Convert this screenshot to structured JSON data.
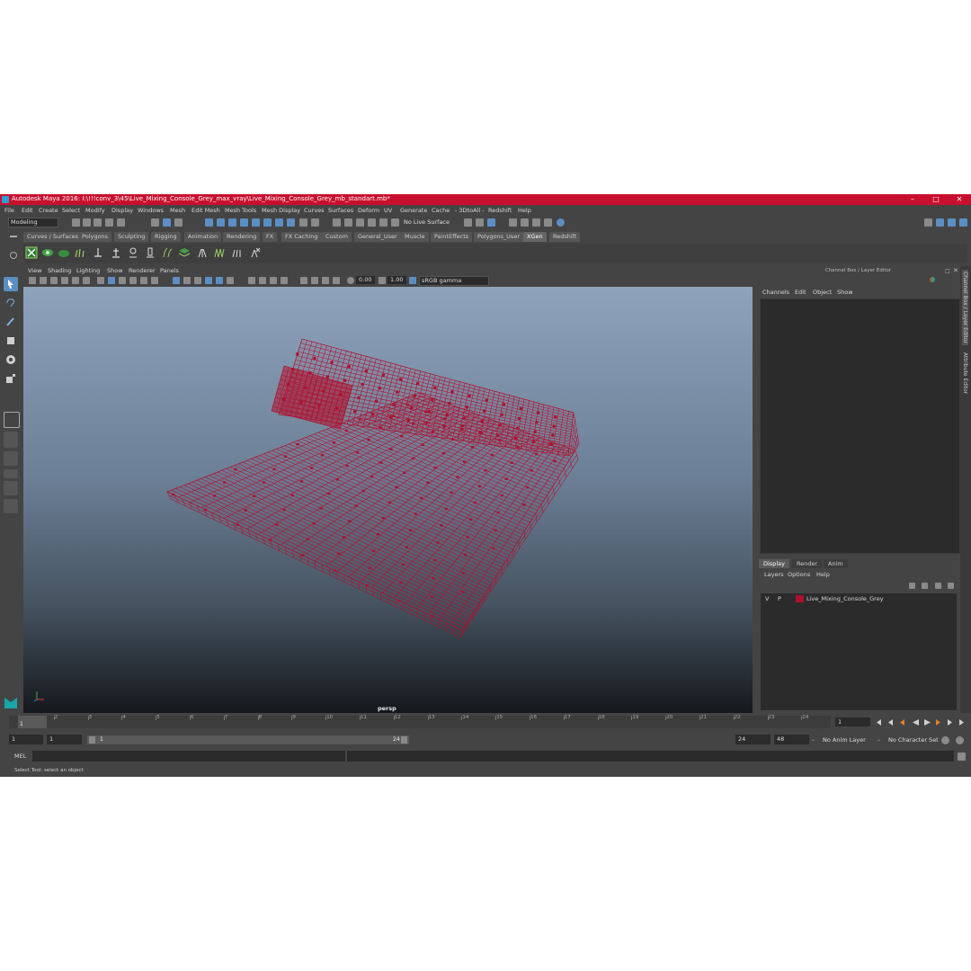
{
  "window": {
    "title": "Autodesk Maya 2016: I:\\!!!conv_3\\45\\Live_Mixing_Console_Grey_max_vray\\Live_Mixing_Console_Grey_mb_standart.mb*"
  },
  "menubar": [
    "File",
    "Edit",
    "Create",
    "Select",
    "Modify",
    "Display",
    "Windows",
    "Mesh",
    "Edit Mesh",
    "Mesh Tools",
    "Mesh Display",
    "Curves",
    "Surfaces",
    "Deform",
    "UV",
    "Generate",
    "Cache",
    "- 3DtoAll -",
    "Redshift",
    "Help"
  ],
  "status": {
    "mode": "Modeling",
    "live_surface": "No Live Surface"
  },
  "shelf_tabs": [
    "Curves / Surfaces",
    "Polygons",
    "Sculpting",
    "Rigging",
    "Animation",
    "Rendering",
    "FX",
    "FX Caching",
    "Custom",
    "General_User",
    "Muscle",
    "PaintEffects",
    "Polygons_User",
    "XGen",
    "Redshift"
  ],
  "shelf_active": "XGen",
  "viewport": {
    "menu": [
      "View",
      "Shading",
      "Lighting",
      "Show",
      "Renderer",
      "Panels"
    ],
    "exposure": "0.00",
    "gamma": "1.00",
    "color_space": "sRGB gamma",
    "camera": "persp",
    "wire_color": "#b0102e"
  },
  "channel_box": {
    "header": "Channel Box / Layer Editor",
    "menu": [
      "Channels",
      "Edit",
      "Object",
      "Show"
    ]
  },
  "layer_editor": {
    "tabs": [
      "Display",
      "Render",
      "Anim"
    ],
    "active_tab": "Display",
    "menu": [
      "Layers",
      "Options",
      "Help"
    ],
    "layers": [
      {
        "v": "V",
        "p": "P",
        "name": "Live_Mixing_Console_Grey",
        "color": "#b0102e"
      }
    ]
  },
  "side_tabs": [
    "Channel Box / Layer Editor",
    "Attribute Editor"
  ],
  "timeline": {
    "ticks": [
      "1",
      "2",
      "3",
      "4",
      "5",
      "6",
      "7",
      "8",
      "9",
      "10",
      "11",
      "12",
      "13",
      "14",
      "15",
      "16",
      "17",
      "18",
      "19",
      "20",
      "21",
      "22",
      "23",
      "24"
    ],
    "current_frame": "1"
  },
  "range": {
    "start": "1",
    "playback_start": "1",
    "slider_start": "1",
    "slider_end": "24",
    "end": "24",
    "total_end": "48",
    "anim_layer": "No Anim Layer",
    "char_set": "No Character Set"
  },
  "command": {
    "lang": "MEL"
  },
  "help": "Select Tool: select an object"
}
